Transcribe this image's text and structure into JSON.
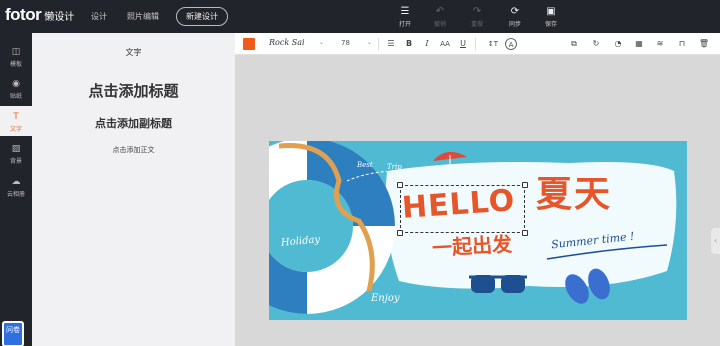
{
  "header": {
    "logo": "fotor",
    "logo_sub": "懒设计",
    "nav": [
      "设计",
      "照片编辑"
    ],
    "new_design": "新建设计",
    "actions": [
      {
        "label": "打开",
        "icon": "menu-icon",
        "disabled": false
      },
      {
        "label": "撤销",
        "icon": "undo-icon",
        "disabled": true
      },
      {
        "label": "重做",
        "icon": "redo-icon",
        "disabled": true
      },
      {
        "label": "同步",
        "icon": "sync-icon",
        "disabled": false
      },
      {
        "label": "保存",
        "icon": "save-icon",
        "disabled": false
      }
    ]
  },
  "sidebar": {
    "items": [
      {
        "label": "模板",
        "icon": "template-icon"
      },
      {
        "label": "贴纸",
        "icon": "sticker-icon"
      },
      {
        "label": "文字",
        "icon": "text-icon",
        "active": true
      },
      {
        "label": "背景",
        "icon": "background-icon"
      },
      {
        "label": "云相册",
        "icon": "cloud-upload-icon"
      }
    ],
    "help": "问卷"
  },
  "panel": {
    "title": "文字",
    "add_title": "点击添加标题",
    "add_subtitle": "点击添加副标题",
    "add_body": "点击添加正文"
  },
  "toolbar": {
    "color": "#f05a1a",
    "font": "Rock Sai",
    "size": "78"
  },
  "canvas": {
    "hello": "HELLO",
    "summer_cn": "夏天",
    "go": "一起出发",
    "summer_time": "Summer time !",
    "holiday": "Holiday",
    "enjoy": "Enjoy",
    "best": "Best",
    "trip": "Trip",
    "bg_color": "#4fbad2",
    "accent": "#e5562a"
  }
}
